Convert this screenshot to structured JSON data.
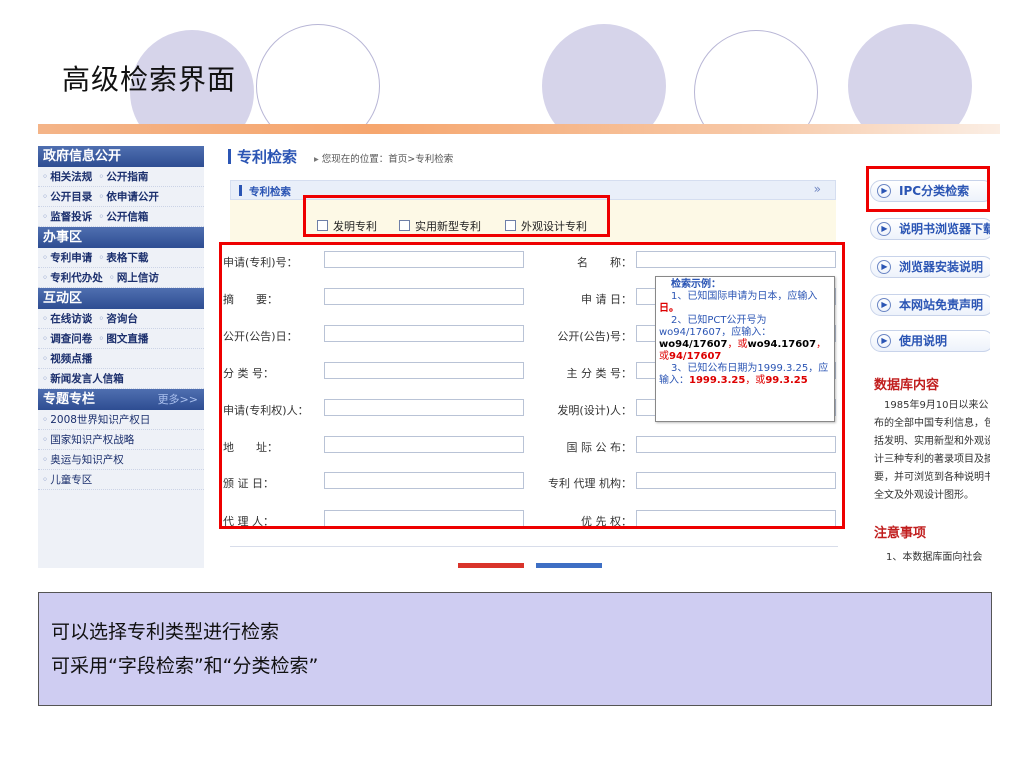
{
  "slide": {
    "title": "高级检索界面",
    "summary": [
      "可以选择专利类型进行检索",
      "可采用“字段检索”和“分类检索”"
    ]
  },
  "left_nav": {
    "sections": [
      {
        "header": "政府信息公开",
        "rows": [
          [
            "相关法规",
            "公开指南"
          ],
          [
            "公开目录",
            "依申请公开"
          ],
          [
            "监督投诉",
            "公开信箱"
          ]
        ]
      },
      {
        "header": "办事区",
        "rows": [
          [
            "专利申请",
            "表格下载"
          ],
          [
            "专利代办处",
            "网上信访"
          ]
        ]
      },
      {
        "header": "互动区",
        "rows": [
          [
            "在线访谈",
            "咨询台"
          ],
          [
            "调查问卷",
            "图文直播"
          ],
          [
            "视频点播"
          ],
          [
            "新闻发言人信箱"
          ]
        ]
      },
      {
        "header": "专题专栏",
        "more": "更多>>",
        "rows": [
          [
            "2008世界知识产权日"
          ],
          [
            "国家知识产权战略"
          ],
          [
            "奥运与知识产权"
          ],
          [
            "儿童专区"
          ]
        ]
      }
    ]
  },
  "main": {
    "title": "专利检索",
    "breadcrumb": "您现在的位置：首页>专利检索",
    "panel_title": "专利检索",
    "panel_expand": "»",
    "patent_types": [
      "发明专利",
      "实用新型专利",
      "外观设计专利"
    ],
    "fields_left": [
      "申请(专利)号：",
      "摘　　要：",
      "公开(公告)日：",
      "分 类 号：",
      "申请(专利权)人：",
      "地　　址：",
      "颁 证 日：",
      "代 理 人："
    ],
    "fields_right": [
      "名　　称：",
      "申 请 日：",
      "公开(公告)号：",
      "主 分 类 号：",
      "发明(设计)人：",
      "国 际 公 布：",
      "专利 代理 机构：",
      "优 先 权："
    ]
  },
  "tooltip": {
    "title": "检索示例：",
    "item1_text": "1、已知国际申请为日本，应输入",
    "item1_example": "日。",
    "item2_text": "2、已知PCT公开号为wo94/17607，应输入：",
    "item2_example_a": "wo94/17607",
    "item2_sep": "，或",
    "item2_example_b": "wo94.17607",
    "item2_sep2": "，或",
    "item2_example_c": "94/17607",
    "item3_text": "3、已知公布日期为1999.3.25，应输入：",
    "item3_example_a": "1999.3.25",
    "item3_sep": "，或",
    "item3_example_b": "99.3.25"
  },
  "right_col": {
    "buttons": [
      "IPC分类检索",
      "说明书浏览器下载",
      "浏览器安装说明",
      "本网站免责声明",
      "使用说明"
    ],
    "db_title": "数据库内容",
    "db_lines": [
      "　1985年9月10日以来公",
      "布的全部中国专利信息，包",
      "括发明、实用新型和外观设",
      "计三种专利的著录项目及摘",
      "要，并可浏览到各种说明书",
      "全文及外观设计图形。"
    ],
    "note_title": "注意事项",
    "note_line": "1、本数据库面向社会"
  },
  "colors": {
    "highlight_red": "#e00000",
    "nav_header": "#2e4d92",
    "link_blue": "#2b55b4",
    "summary_bg": "#cfcdf2",
    "circle": "#d6d4ea"
  }
}
